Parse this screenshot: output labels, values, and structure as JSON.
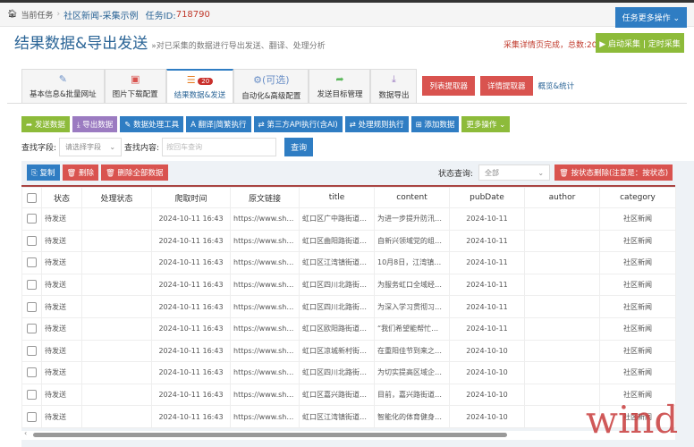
{
  "breadcrumb": {
    "home": "当前任务",
    "task": "社区新闻-采集示例",
    "id_label": "任务ID:",
    "id": "718790"
  },
  "more_ops": "任务更多操作 ⌄",
  "header": {
    "title": "结果数据&导出发送",
    "subtitle": "»对已采集的数据进行导出发送、翻译、处理分析",
    "status": "采集详情页完成，总数:20",
    "start": "▶ 启动采集 | 定时采集"
  },
  "tabs": [
    {
      "icon": "✎",
      "label": "基本信息&批量网址"
    },
    {
      "icon": "▣",
      "label": "图片下载配置"
    },
    {
      "icon": "☰",
      "badge": "20",
      "label": "结果数据&发送"
    },
    {
      "icon": "⚙(可选)",
      "label": "自动化&高级配置"
    },
    {
      "icon": "➦",
      "label": "发送目标管理"
    },
    {
      "icon": "⤓",
      "label": "数据导出"
    }
  ],
  "tab_buttons": [
    "列表提取器",
    "详情提取器"
  ],
  "tab_link": "概览&统计",
  "toolbar": [
    "➦ 发送数据",
    "⤓ 导出数据",
    "✎ 数据处理工具",
    "A 翻译|简繁执行",
    "⇄ 第三方API执行(含AI)",
    "⇄ 处理规则执行",
    "⊞ 添加数据",
    "更多操作 ⌄"
  ],
  "search": {
    "field_label": "查找字段:",
    "field_placeholder": "请选择字段",
    "content_label": "查找内容:",
    "content_placeholder": "按回车查询",
    "button": "查询"
  },
  "actions": {
    "copy": "⎘ 复制",
    "delete": "🗑 删除",
    "delete_all": "🗑 删除全部数据",
    "status_label": "状态查询:",
    "status_value": "全部",
    "delete_by_status": "🗑 按状态删除(注意是：按状态)"
  },
  "columns": [
    "状态",
    "处理状态",
    "爬取时间",
    "原文链接",
    "title",
    "content",
    "pubDate",
    "author",
    "category"
  ],
  "rows": [
    [
      "待发送",
      "",
      "2024-10-11 16:43",
      "https://www.sh…",
      "虹口区广中路街道…",
      "为进一步提升防汛…",
      "2024-10-11",
      "",
      "社区新闻"
    ],
    [
      "待发送",
      "",
      "2024-10-11 16:43",
      "https://www.sh…",
      "虹口区曲阳路街道…",
      "自新兴领域党的组…",
      "2024-10-11",
      "",
      "社区新闻"
    ],
    [
      "待发送",
      "",
      "2024-10-11 16:43",
      "https://www.sh…",
      "虹口区江湾镇街道…",
      "10月8日，江湾镇…",
      "2024-10-11",
      "",
      "社区新闻"
    ],
    [
      "待发送",
      "",
      "2024-10-11 16:43",
      "https://www.sh…",
      "虹口区四川北路街…",
      "为服务虹口全域经…",
      "2024-10-11",
      "",
      "社区新闻"
    ],
    [
      "待发送",
      "",
      "2024-10-11 16:43",
      "https://www.sh…",
      "虹口区四川北路街…",
      "为深入学习贯彻习…",
      "2024-10-11",
      "",
      "社区新闻"
    ],
    [
      "待发送",
      "",
      "2024-10-11 16:43",
      "https://www.sh…",
      "虹口区欧阳路街道…",
      "“我们希望能帮忙…",
      "2024-10-11",
      "",
      "社区新闻"
    ],
    [
      "待发送",
      "",
      "2024-10-11 16:43",
      "https://www.sh…",
      "虹口区凉城新村街…",
      "在重阳佳节到来之…",
      "2024-10-10",
      "",
      "社区新闻"
    ],
    [
      "待发送",
      "",
      "2024-10-11 16:43",
      "https://www.sh…",
      "虹口区四川北路街…",
      "为切实提高区域企…",
      "2024-10-10",
      "",
      "社区新闻"
    ],
    [
      "待发送",
      "",
      "2024-10-11 16:43",
      "https://www.sh…",
      "虹口区嘉兴路街道…",
      "目前，嘉兴路街道…",
      "2024-10-10",
      "",
      "社区新闻"
    ],
    [
      "待发送",
      "",
      "2024-10-11 16:43",
      "https://www.sh…",
      "虹口区江湾镇街道…",
      "智能化的体育健身…",
      "2024-10-10",
      "",
      "社区新闻"
    ]
  ],
  "watermark": "wind"
}
